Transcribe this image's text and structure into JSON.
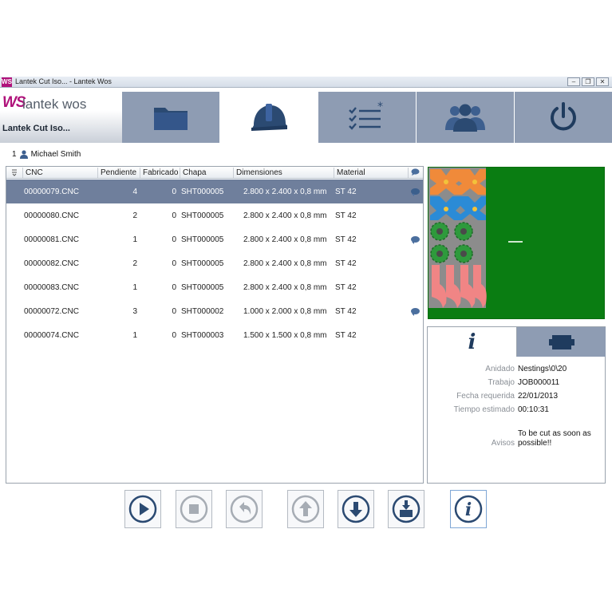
{
  "window": {
    "app_icon": "WS",
    "title": "Lantek Cut Iso... - Lantek Wos",
    "minimize": "–",
    "maximize": "❐",
    "close": "✕"
  },
  "logo": {
    "ws": "WS",
    "brand": "lantek wos",
    "subtitle": "Lantek Cut Iso..."
  },
  "nav_icons": [
    "folder-icon",
    "hard-hat-icon",
    "checklist-icon",
    "users-icon",
    "power-icon"
  ],
  "operator": {
    "count": "1",
    "name": "Michael Smith"
  },
  "table": {
    "columns": [
      "CNC",
      "Pendiente",
      "Fabricado",
      "Chapa",
      "Dimensiones",
      "Material"
    ],
    "rows": [
      {
        "cnc": "00000079.CNC",
        "pendiente": "4",
        "fabricado": "0",
        "chapa": "SHT000005",
        "dimensiones": "2.800 x 2.400 x 0,8 mm",
        "material": "ST 42",
        "note": true
      },
      {
        "cnc": "00000080.CNC",
        "pendiente": "2",
        "fabricado": "0",
        "chapa": "SHT000005",
        "dimensiones": "2.800 x 2.400 x 0,8 mm",
        "material": "ST 42",
        "note": false
      },
      {
        "cnc": "00000081.CNC",
        "pendiente": "1",
        "fabricado": "0",
        "chapa": "SHT000005",
        "dimensiones": "2.800 x 2.400 x 0,8 mm",
        "material": "ST 42",
        "note": true
      },
      {
        "cnc": "00000082.CNC",
        "pendiente": "2",
        "fabricado": "0",
        "chapa": "SHT000005",
        "dimensiones": "2.800 x 2.400 x 0,8 mm",
        "material": "ST 42",
        "note": false
      },
      {
        "cnc": "00000083.CNC",
        "pendiente": "1",
        "fabricado": "0",
        "chapa": "SHT000005",
        "dimensiones": "2.800 x 2.400 x 0,8 mm",
        "material": "ST 42",
        "note": false
      },
      {
        "cnc": "00000072.CNC",
        "pendiente": "3",
        "fabricado": "0",
        "chapa": "SHT000002",
        "dimensiones": "1.000 x 2.000 x 0,8 mm",
        "material": "ST 42",
        "note": true
      },
      {
        "cnc": "00000074.CNC",
        "pendiente": "1",
        "fabricado": "0",
        "chapa": "SHT000003",
        "dimensiones": "1.500 x 1.500 x 0,8 mm",
        "material": "ST 42",
        "note": false
      }
    ],
    "selected_index": 0
  },
  "info": {
    "tab_info_label": "i",
    "fields": [
      {
        "key": "Anidado",
        "value": "Nestings\\0\\20"
      },
      {
        "key": "Trabajo",
        "value": "JOB000011"
      },
      {
        "key": "Fecha requerida",
        "value": "22/01/2013"
      },
      {
        "key": "Tiempo estimado",
        "value": "00:10:31"
      }
    ],
    "avisos_key": "Avisos",
    "avisos_value": "To be cut as soon as possible!!"
  },
  "bottom_buttons": [
    "play-icon",
    "stop-icon",
    "undo-icon",
    "arrow-up-icon",
    "arrow-down-icon",
    "download-icon",
    "info-icon"
  ],
  "colors": {
    "accent": "#b0127a",
    "nav": "#8e9cb3",
    "selected_row": "#6f7f9c",
    "icon_blue": "#2b4a72",
    "preview_green": "#0a7d12"
  }
}
